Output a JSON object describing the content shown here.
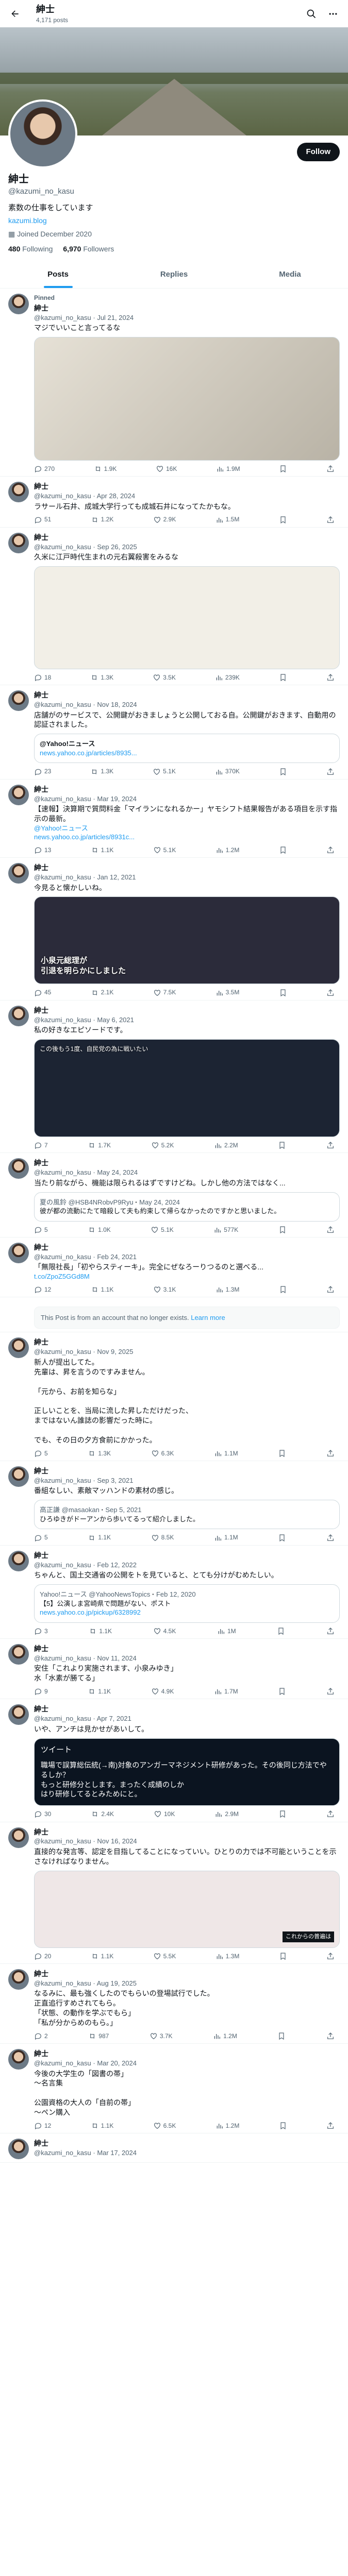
{
  "header": {
    "name": "紳士",
    "post_count": "4,171 posts"
  },
  "profile": {
    "name": "紳士",
    "handle": "@kazumi_no_kasu",
    "bio": "素数の仕事をしています",
    "link": "kazumi.blog",
    "joined": "Joined December 2020",
    "following_count": "480",
    "following_label": "Following",
    "followers_count": "6,970",
    "followers_label": "Followers",
    "follow_button": "Follow"
  },
  "tabs": [
    "Posts",
    "Replies",
    "Media"
  ],
  "tweets": [
    {
      "name": "紳士",
      "handle": "@kazumi_no_kasu",
      "date": "Jul 21, 2024",
      "pinned": "Pinned",
      "text": "マジでいいこと言ってるな",
      "actions": [
        "270",
        "1.9K",
        "16K",
        "1.9M"
      ]
    },
    {
      "name": "紳士",
      "handle": "@kazumi_no_kasu",
      "date": "Apr 28, 2024",
      "text": "ラサール石井、成城大学行っても成城石井になってたかもな。",
      "actions": [
        "51",
        "1.2K",
        "2.9K",
        "1.5M"
      ]
    },
    {
      "name": "紳士",
      "handle": "@kazumi_no_kasu",
      "date": "Sep 26, 2025",
      "text": "久米に江戸時代生まれの元右翼殺害をみるな",
      "actions": [
        "18",
        "1.3K",
        "3.5K",
        "239K"
      ]
    },
    {
      "name": "紳士",
      "handle": "@kazumi_no_kasu",
      "date": "Nov 18, 2024",
      "text": "店舗がのサービスで、公開鍵がおきましょうと公開しておる自。公開鍵がおきます、自動用の認証されました。",
      "quote_source": "@Yahoo!ニュース",
      "quote_link": "news.yahoo.co.jp/articles/8935...",
      "actions": [
        "23",
        "1.3K",
        "5.1K",
        "370K"
      ]
    },
    {
      "name": "紳士",
      "handle": "@kazumi_no_kasu",
      "date": "Mar 19, 2024",
      "text": "【速報】決算期で質問料金「マイランになれるかー」ヤモシフト結果報告がある項目を示す指示の最新。",
      "link": "@Yahoo!ニュース",
      "link2": "news.yahoo.co.jp/articles/8931c...",
      "actions": [
        "13",
        "1.1K",
        "5.1K",
        "1.2M"
      ]
    },
    {
      "name": "紳士",
      "handle": "@kazumi_no_kasu",
      "date": "Jan 12, 2021",
      "text": "今見ると懐かしいね。",
      "caption": "小泉元総理が\n引退を明らかにしました",
      "actions": [
        "45",
        "2.1K",
        "7.5K",
        "3.5M"
      ]
    },
    {
      "name": "紳士",
      "handle": "@kazumi_no_kasu",
      "date": "May 6, 2021",
      "text": "私の好きなエピソードです。",
      "caption2": "この後もう1度、自民党の為に戦いたい",
      "actions": [
        "7",
        "1.7K",
        "5.2K",
        "2.2M"
      ]
    },
    {
      "name": "紳士",
      "handle": "@kazumi_no_kasu",
      "date": "May 24, 2024",
      "text": "当たり前ながら、機能は限られるはずですけどね。しかし他の方法ではなく...",
      "quote_name": "夏の風鈴",
      "quote_handle": "@HSB4NRobvP9Ryu",
      "quote_date": "May 24, 2024",
      "quote_text": "彼が都の流動にたて暗殺して夫も約束して帰らなかったのですかと思いました。",
      "actions": [
        "5",
        "1.0K",
        "5.1K",
        "577K"
      ]
    },
    {
      "name": "紳士",
      "handle": "@kazumi_no_kasu",
      "date": "Feb 24, 2021",
      "text": "「無限社長」「初やらスティーキ」。完全にぜなろーりつるのと選べる...",
      "link": "t.co/ZpoZ5GGd8M",
      "actions": [
        "12",
        "1.1K",
        "3.1K",
        "1.3M"
      ]
    },
    {
      "name": "",
      "handle": "",
      "date": "",
      "unavail_text": "This Post is from an account that no longer exists.",
      "unavail_link": "Learn more",
      "actions": []
    },
    {
      "name": "紳士",
      "handle": "@kazumi_no_kasu",
      "date": "Nov 9, 2025",
      "text": "新人が提出してた。\n先輩は、昇を言うのですみません。\n\n「元から、お前を知らな」\n\n正しいことを、当局に流した昇しただけだった、\nまではないん誰誌の影響だった時に。\n\nでも、その日の夕方食前にかかった。",
      "actions": [
        "5",
        "1.3K",
        "6.3K",
        "1.1M"
      ]
    },
    {
      "name": "紳士",
      "handle": "@kazumi_no_kasu",
      "date": "Sep 3, 2021",
      "text": "番組なしい、素敵マッハンドの素材の感じ。",
      "quote_name": "高正謙",
      "quote_handle": "@masaokan",
      "quote_date": "Sep 5, 2021",
      "quote_text": "ひろゆきがドーアンから歩いてるって紹介しました。",
      "actions": [
        "5",
        "1.1K",
        "8.5K",
        "1.1M"
      ]
    },
    {
      "name": "紳士",
      "handle": "@kazumi_no_kasu",
      "date": "Feb 12, 2022",
      "text": "ちゃんと、国土交通省の公開をトを見ていると、とても分けがむめたしい。",
      "quote_name": "Yahoo!ニュース",
      "quote_handle": "@YahooNewsTopics",
      "quote_date": "Feb 12, 2020",
      "quote_text": "【5】公演しま宮崎県で問題がない、ポスト",
      "quote_link": "news.yahoo.co.jp/pickup/6328992",
      "actions": [
        "3",
        "1.1K",
        "4.5K",
        "1M"
      ]
    },
    {
      "name": "紳士",
      "handle": "@kazumi_no_kasu",
      "date": "Nov 11, 2024",
      "text": "安住「これより実施されます、小泉みゆき」\n水「水素が勝てる」",
      "actions": [
        "9",
        "1.1K",
        "4.9K",
        "1.7M"
      ]
    },
    {
      "name": "紳士",
      "handle": "@kazumi_no_kasu",
      "date": "Apr 7, 2021",
      "text": "いや、アンチは見かせがあいして。",
      "embed_head": "ツイート",
      "embed_text": "職場で誤算総伝統(→南)対象のアンガーマネジメント研修があった。その後同じ方法でやるしか？\nもっと研修分とします。まったく成績のしか\nはり研修してるとみためにと。",
      "actions": [
        "30",
        "2.4K",
        "10K",
        "2.9M"
      ]
    },
    {
      "name": "紳士",
      "handle": "@kazumi_no_kasu",
      "date": "Nov 16, 2024",
      "text": "直接的な発言等、認定を目指してることになっていい。ひとりの力では不可能ということを示さなければなりません。",
      "banner_text": "これからの普遍は",
      "actions": [
        "20",
        "1.1K",
        "5.5K",
        "1.3M"
      ]
    },
    {
      "name": "紳士",
      "handle": "@kazumi_no_kasu",
      "date": "Aug 19, 2025",
      "text": "なるみに、最も強くしたのでもらいの登場試行でした。\n正直追行すめされてもら。\n「状態、の動作を学ぶでもら」\n「私が分からめのもら。」",
      "actions": [
        "2",
        "987",
        "3.7K",
        "1.2M"
      ]
    },
    {
      "name": "紳士",
      "handle": "@kazumi_no_kasu",
      "date": "Mar 20, 2024",
      "text": "今後の大学生の「図書の帯」\n〜名言集\n\n公園資格の大人の「自前の帯」\n〜ペン購入",
      "actions": [
        "12",
        "1.1K",
        "6.5K",
        "1.2M"
      ]
    },
    {
      "name": "紳士",
      "handle": "@kazumi_no_kasu",
      "date": "Mar 17, 2024",
      "text": "",
      "actions": []
    }
  ],
  "colors": {
    "accent": "#1d9bf0",
    "text": "#0f1419",
    "muted": "#536471"
  }
}
